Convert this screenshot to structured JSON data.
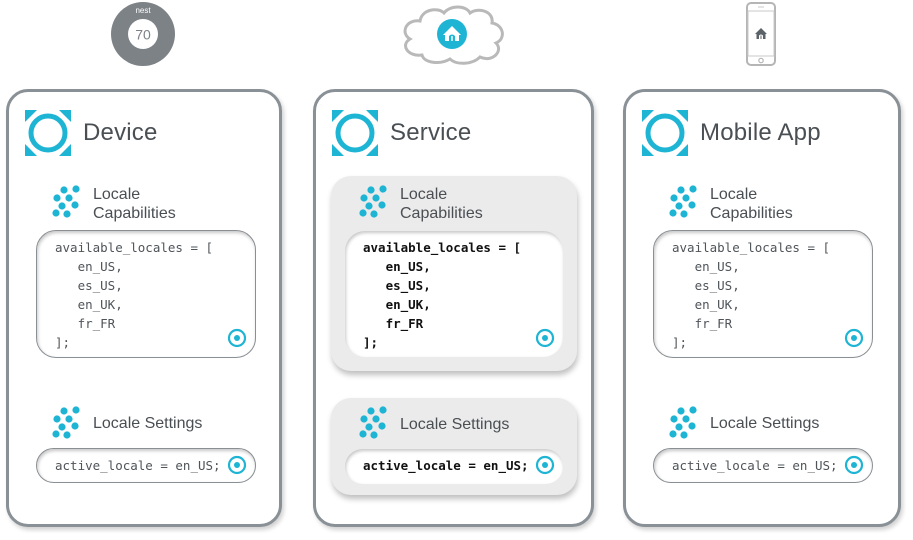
{
  "top_icons": {
    "device": {
      "icon": "nest-thermostat-icon",
      "brand": "nest",
      "temperature": "70"
    },
    "service": {
      "icon": "cloud-home-icon"
    },
    "mobile": {
      "icon": "phone-home-icon"
    }
  },
  "colors": {
    "accent": "#1eb4d4",
    "border": "#8a9196",
    "text": "#4a4f54",
    "panel": "#ebebeb",
    "nest_gray": "#7d8287"
  },
  "cards": [
    {
      "title": "Device",
      "capabilities_label": [
        "Locale",
        "Capabilities"
      ],
      "capabilities_code": [
        "available_locales = [",
        "   en_US,",
        "   es_US,",
        "   en_UK,",
        "   fr_FR",
        "];"
      ],
      "settings_label": "Locale Settings",
      "settings_code": "active_locale = en_US;"
    },
    {
      "title": "Service",
      "capabilities_label": [
        "Locale",
        "Capabilities"
      ],
      "capabilities_code": [
        "available_locales = [",
        "   en_US,",
        "   es_US,",
        "   en_UK,",
        "   fr_FR",
        "];"
      ],
      "settings_label": "Locale Settings",
      "settings_code": "active_locale = en_US;"
    },
    {
      "title": "Mobile App",
      "capabilities_label": [
        "Locale",
        "Capabilities"
      ],
      "capabilities_code": [
        "available_locales = [",
        "   en_US,",
        "   es_US,",
        "   en_UK,",
        "   fr_FR",
        "];"
      ],
      "settings_label": "Locale Settings",
      "settings_code": "active_locale = en_US;"
    }
  ]
}
